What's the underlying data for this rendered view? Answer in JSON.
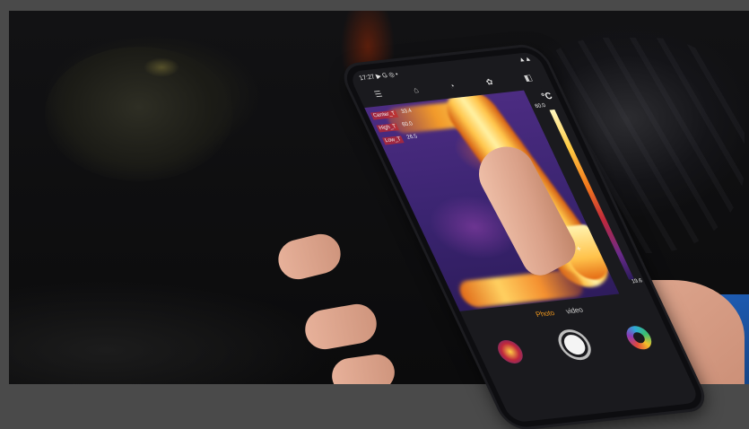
{
  "status_bar": {
    "time": "17:27 ▶ G ◎ •",
    "signal": "▲▲"
  },
  "toolbar": {
    "items": [
      "☰",
      "⌂",
      "◔",
      "✿",
      "◧"
    ]
  },
  "readouts": [
    {
      "label": "Center_T",
      "value": "33.4"
    },
    {
      "label": "High_T",
      "value": "60.0"
    },
    {
      "label": "Low_T",
      "value": "26.5"
    }
  ],
  "temperature_scale": {
    "unit": "°C",
    "max": "60.0",
    "min": "19.6"
  },
  "modes": {
    "photo": "Photo",
    "video": "video"
  },
  "colors": {
    "accent": "#f39a1e",
    "sleeve": "#1f5fb8"
  },
  "icons": {
    "gallery": "gallery-thumbnail-icon",
    "shutter": "shutter-icon",
    "palette": "palette-icon"
  }
}
